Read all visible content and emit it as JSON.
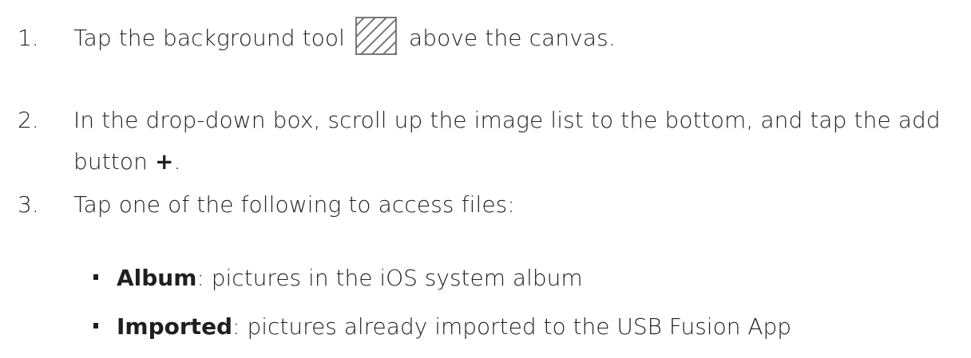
{
  "steps": [
    {
      "number": "1.",
      "text_before_icon": "Tap the background tool",
      "icon": "background-tool-icon",
      "text_after_icon": "above the canvas."
    },
    {
      "number": "2.",
      "text_main": "In the drop-down box, scroll up the image list to the bottom, and tap the add button ",
      "plus_symbol": "+",
      "text_end": "."
    },
    {
      "number": "3.",
      "text": "Tap one of the following to access files:"
    }
  ],
  "options": [
    {
      "term": "Album",
      "description": ": pictures in the iOS system album"
    },
    {
      "term": "Imported",
      "description": ": pictures already imported to the USB Fusion App"
    }
  ]
}
